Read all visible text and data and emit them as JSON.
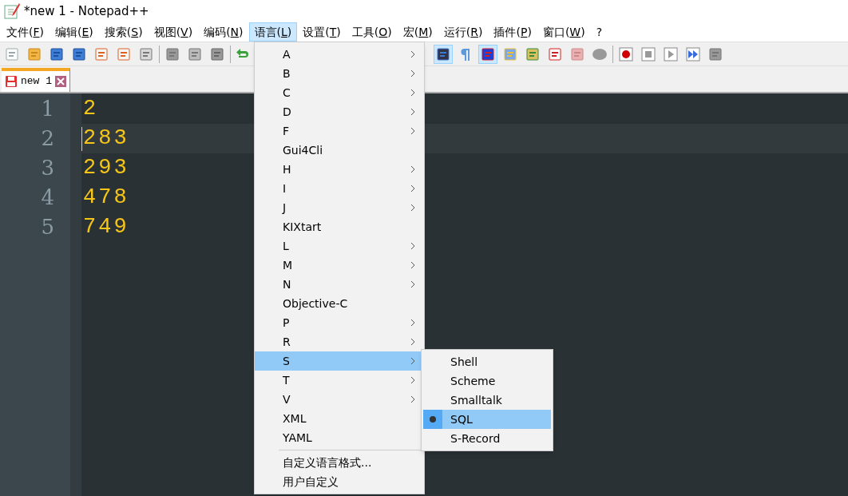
{
  "window": {
    "title": "*new 1 - Notepad++"
  },
  "menubar": [
    {
      "label": "文件(F)",
      "selected": false
    },
    {
      "label": "编辑(E)",
      "selected": false
    },
    {
      "label": "搜索(S)",
      "selected": false
    },
    {
      "label": "视图(V)",
      "selected": false
    },
    {
      "label": "编码(N)",
      "selected": false
    },
    {
      "label": "语言(L)",
      "selected": true
    },
    {
      "label": "设置(T)",
      "selected": false
    },
    {
      "label": "工具(O)",
      "selected": false
    },
    {
      "label": "宏(M)",
      "selected": false
    },
    {
      "label": "运行(R)",
      "selected": false
    },
    {
      "label": "插件(P)",
      "selected": false
    },
    {
      "label": "窗口(W)",
      "selected": false
    },
    {
      "label": "?",
      "selected": false
    }
  ],
  "toolbar": [
    {
      "pressed": false
    },
    {
      "pressed": false
    },
    {
      "pressed": false
    },
    {
      "pressed": false
    },
    {
      "pressed": false
    },
    {
      "pressed": false
    },
    {
      "pressed": false
    },
    {
      "pressed": false
    },
    {
      "pressed": false
    },
    {
      "pressed": false
    },
    {
      "pressed": false
    },
    {
      "pressed": true
    },
    {
      "pressed": false
    },
    {
      "pressed": true
    },
    {
      "pressed": false
    },
    {
      "pressed": false
    },
    {
      "pressed": false
    },
    {
      "pressed": false
    },
    {
      "pressed": false
    },
    {
      "pressed": false
    },
    {
      "pressed": false
    },
    {
      "pressed": false
    },
    {
      "pressed": false
    },
    {
      "pressed": false
    }
  ],
  "tabs": [
    {
      "label": "new 1",
      "selected": true,
      "modified": true
    }
  ],
  "editor": {
    "lines": [
      {
        "number": "1",
        "text": "2",
        "current": false
      },
      {
        "number": "2",
        "text": "283",
        "current": true
      },
      {
        "number": "3",
        "text": "293",
        "current": false
      },
      {
        "number": "4",
        "text": "478",
        "current": false
      },
      {
        "number": "5",
        "text": "749",
        "current": false
      }
    ]
  },
  "language_menu": {
    "items": [
      {
        "label": "A",
        "submenu": true,
        "selected": false
      },
      {
        "label": "B",
        "submenu": true,
        "selected": false
      },
      {
        "label": "C",
        "submenu": true,
        "selected": false
      },
      {
        "label": "D",
        "submenu": true,
        "selected": false
      },
      {
        "label": "F",
        "submenu": true,
        "selected": false
      },
      {
        "label": "Gui4Cli",
        "submenu": false,
        "selected": false
      },
      {
        "label": "H",
        "submenu": true,
        "selected": false
      },
      {
        "label": "I",
        "submenu": true,
        "selected": false
      },
      {
        "label": "J",
        "submenu": true,
        "selected": false
      },
      {
        "label": "KIXtart",
        "submenu": false,
        "selected": false
      },
      {
        "label": "L",
        "submenu": true,
        "selected": false
      },
      {
        "label": "M",
        "submenu": true,
        "selected": false
      },
      {
        "label": "N",
        "submenu": true,
        "selected": false
      },
      {
        "label": "Objective-C",
        "submenu": false,
        "selected": false
      },
      {
        "label": "P",
        "submenu": true,
        "selected": false
      },
      {
        "label": "R",
        "submenu": true,
        "selected": false
      },
      {
        "label": "S",
        "submenu": true,
        "selected": true
      },
      {
        "label": "T",
        "submenu": true,
        "selected": false
      },
      {
        "label": "V",
        "submenu": true,
        "selected": false
      },
      {
        "label": "XML",
        "submenu": false,
        "selected": false
      },
      {
        "label": "YAML",
        "submenu": false,
        "selected": false
      }
    ],
    "extra_items": [
      {
        "label": "自定义语言格式..."
      },
      {
        "label": "用户自定义"
      }
    ]
  },
  "s_submenu": {
    "items": [
      {
        "label": "Shell",
        "checked": false,
        "selected": false
      },
      {
        "label": "Scheme",
        "checked": false,
        "selected": false
      },
      {
        "label": "Smalltalk",
        "checked": false,
        "selected": false
      },
      {
        "label": "SQL",
        "checked": true,
        "selected": true
      },
      {
        "label": "S-Record",
        "checked": false,
        "selected": false
      }
    ]
  }
}
